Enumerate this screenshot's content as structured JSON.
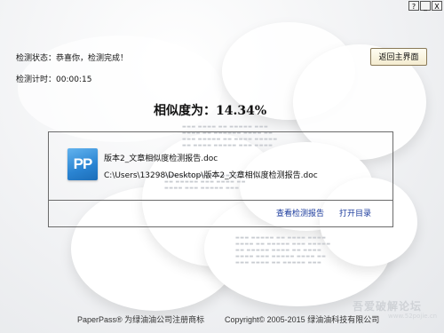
{
  "window": {
    "help_label": "?",
    "minimize_label": "_",
    "close_label": "X"
  },
  "status": {
    "detect_status": "检测状态：恭喜你，检测完成！",
    "detect_timer": "检测计时：00:00:15"
  },
  "home_button": {
    "label": "返回主界面"
  },
  "similarity": {
    "text": "相似度为：14.34%"
  },
  "result_file": {
    "icon_text": "PP",
    "name": "版本2_文章相似度检测报告.doc",
    "path": "C:\\Users\\13298\\Desktop\\版本2_文章相似度检测报告.doc"
  },
  "actions": {
    "view_report": "查看检测报告",
    "open_folder": "打开目录"
  },
  "footer": {
    "brand": "PaperPass® 为绿油油公司注册商标",
    "copyright": "Copyright© 2005-2015 绿油油科技有限公司"
  },
  "watermark": {
    "text": "吾爱破解论坛",
    "url": "www.52pojie.cn"
  }
}
